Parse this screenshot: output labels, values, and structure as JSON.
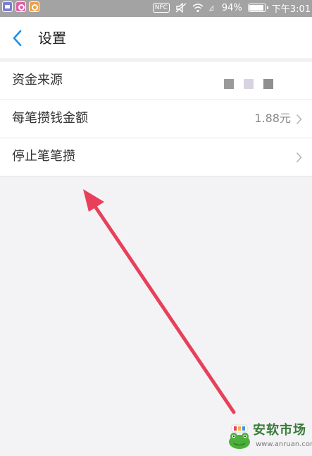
{
  "status_bar": {
    "apps": [
      "message-app-icon",
      "browser-app-icon",
      "search-app-icon"
    ],
    "nfc_label": "NFC",
    "battery_percent": "94%",
    "battery_level": 0.94,
    "time": "下午3:01"
  },
  "nav": {
    "title": "设置"
  },
  "settings": {
    "items": [
      {
        "label": "资金来源",
        "value": "",
        "has_chevron": false
      },
      {
        "label": "每笔攒钱金额",
        "value": "1.88元",
        "has_chevron": true
      },
      {
        "label": "停止笔笔攒",
        "value": "",
        "has_chevron": true
      }
    ],
    "mask_colors": [
      "#9a9a9a",
      "#d8d4df",
      "#8f8f8f"
    ]
  },
  "annotation": {
    "color": "#e8405a",
    "description_icon": "red-arrow-icon"
  },
  "watermark": {
    "name": "安软市场",
    "url": "www.anruan.com"
  },
  "colors": {
    "accent": "#1f8fe5",
    "page_bg": "#f3f3f5",
    "status_bar_bg": "#a3a3a3"
  }
}
